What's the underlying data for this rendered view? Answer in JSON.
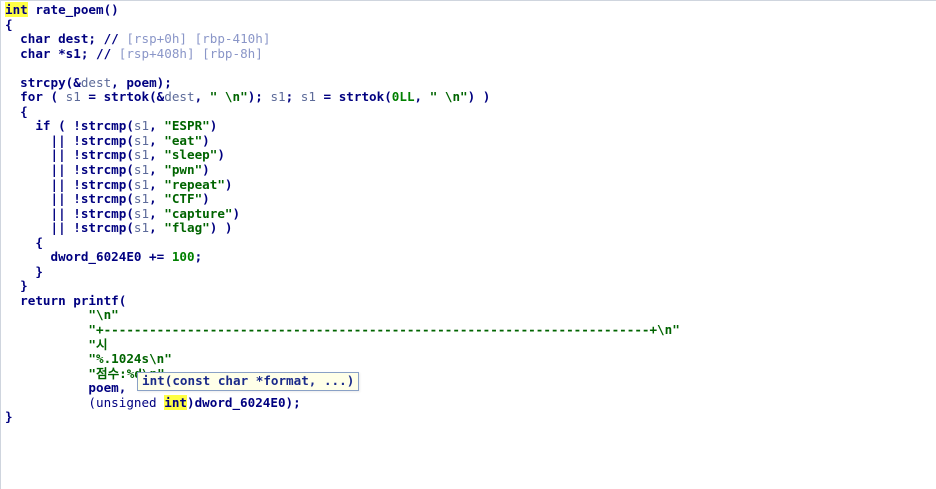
{
  "editor": {
    "lines": [
      [
        {
          "t": "int",
          "c": "kw hl"
        },
        {
          "t": " rate_poem()",
          "c": "id"
        }
      ],
      [
        {
          "t": "{",
          "c": "id"
        }
      ],
      [
        {
          "t": "  char ",
          "c": "kw"
        },
        {
          "t": "dest",
          "c": "id"
        },
        {
          "t": "; // ",
          "c": "id"
        },
        {
          "t": "[rsp+0h] [rbp-410h]",
          "c": "cmt"
        }
      ],
      [
        {
          "t": "  char *",
          "c": "kw"
        },
        {
          "t": "s1",
          "c": "id"
        },
        {
          "t": "; // ",
          "c": "id"
        },
        {
          "t": "[rsp+408h] [rbp-8h]",
          "c": "cmt"
        }
      ],
      [
        {
          "t": "",
          "c": "id"
        }
      ],
      [
        {
          "t": "  strcpy(&",
          "c": "id"
        },
        {
          "t": "dest",
          "c": "var"
        },
        {
          "t": ", poem);",
          "c": "id"
        }
      ],
      [
        {
          "t": "  for ( ",
          "c": "id"
        },
        {
          "t": "s1",
          "c": "var"
        },
        {
          "t": " = strtok(&",
          "c": "id"
        },
        {
          "t": "dest",
          "c": "var"
        },
        {
          "t": ", ",
          "c": "id"
        },
        {
          "t": "\" \\n\"",
          "c": "str"
        },
        {
          "t": "); ",
          "c": "id"
        },
        {
          "t": "s1",
          "c": "var"
        },
        {
          "t": "; ",
          "c": "id"
        },
        {
          "t": "s1",
          "c": "var"
        },
        {
          "t": " = strtok(",
          "c": "id"
        },
        {
          "t": "0LL",
          "c": "num"
        },
        {
          "t": ", ",
          "c": "id"
        },
        {
          "t": "\" \\n\"",
          "c": "str"
        },
        {
          "t": ") )",
          "c": "id"
        }
      ],
      [
        {
          "t": "  {",
          "c": "id"
        }
      ],
      [
        {
          "t": "    if ( !strcmp(",
          "c": "id"
        },
        {
          "t": "s1",
          "c": "var"
        },
        {
          "t": ", ",
          "c": "id"
        },
        {
          "t": "\"ESPR\"",
          "c": "str"
        },
        {
          "t": ")",
          "c": "id"
        }
      ],
      [
        {
          "t": "      || !strcmp(",
          "c": "id"
        },
        {
          "t": "s1",
          "c": "var"
        },
        {
          "t": ", ",
          "c": "id"
        },
        {
          "t": "\"eat\"",
          "c": "str"
        },
        {
          "t": ")",
          "c": "id"
        }
      ],
      [
        {
          "t": "      || !strcmp(",
          "c": "id"
        },
        {
          "t": "s1",
          "c": "var"
        },
        {
          "t": ", ",
          "c": "id"
        },
        {
          "t": "\"sleep\"",
          "c": "str"
        },
        {
          "t": ")",
          "c": "id"
        }
      ],
      [
        {
          "t": "      || !strcmp(",
          "c": "id"
        },
        {
          "t": "s1",
          "c": "var"
        },
        {
          "t": ", ",
          "c": "id"
        },
        {
          "t": "\"pwn\"",
          "c": "str"
        },
        {
          "t": ")",
          "c": "id"
        }
      ],
      [
        {
          "t": "      || !strcmp(",
          "c": "id"
        },
        {
          "t": "s1",
          "c": "var"
        },
        {
          "t": ", ",
          "c": "id"
        },
        {
          "t": "\"repeat\"",
          "c": "str"
        },
        {
          "t": ")",
          "c": "id"
        }
      ],
      [
        {
          "t": "      || !strcmp(",
          "c": "id"
        },
        {
          "t": "s1",
          "c": "var"
        },
        {
          "t": ", ",
          "c": "id"
        },
        {
          "t": "\"CTF\"",
          "c": "str"
        },
        {
          "t": ")",
          "c": "id"
        }
      ],
      [
        {
          "t": "      || !strcmp(",
          "c": "id"
        },
        {
          "t": "s1",
          "c": "var"
        },
        {
          "t": ", ",
          "c": "id"
        },
        {
          "t": "\"capture\"",
          "c": "str"
        },
        {
          "t": ")",
          "c": "id"
        }
      ],
      [
        {
          "t": "      || !strcmp(",
          "c": "id"
        },
        {
          "t": "s1",
          "c": "var"
        },
        {
          "t": ", ",
          "c": "id"
        },
        {
          "t": "\"flag\"",
          "c": "str"
        },
        {
          "t": ") )",
          "c": "id"
        }
      ],
      [
        {
          "t": "    {",
          "c": "id"
        }
      ],
      [
        {
          "t": "      dword_6024E0 += ",
          "c": "id"
        },
        {
          "t": "100",
          "c": "num"
        },
        {
          "t": ";",
          "c": "id"
        }
      ],
      [
        {
          "t": "    }",
          "c": "id"
        }
      ],
      [
        {
          "t": "  }",
          "c": "id"
        }
      ],
      [
        {
          "t": "  return printf(",
          "c": "id"
        }
      ],
      [
        {
          "t": "           ",
          "c": "id"
        },
        {
          "t": "\"\\n\"",
          "c": "str"
        }
      ],
      [
        {
          "t": "           ",
          "c": "id"
        },
        {
          "t": "\"+------------------------------------------------------------------------+\\n\"",
          "c": "str"
        }
      ],
      [
        {
          "t": "           ",
          "c": "id"
        },
        {
          "t": "\"시",
          "c": "str"
        }
      ],
      [
        {
          "t": "           ",
          "c": "id"
        },
        {
          "t": "\"%.1024s\\n\"",
          "c": "str"
        }
      ],
      [
        {
          "t": "           ",
          "c": "id"
        },
        {
          "t": "\"점수:%d\\n\",",
          "c": "str"
        }
      ],
      [
        {
          "t": "           poem,",
          "c": "id"
        }
      ],
      [
        {
          "t": "           (unsigned ",
          "c": "typ"
        },
        {
          "t": "int",
          "c": "kw hl"
        },
        {
          "t": ")dword_6024E0);",
          "c": "id"
        }
      ],
      [
        {
          "t": "}",
          "c": "id"
        }
      ]
    ]
  },
  "tooltip": {
    "text": "int(const char *format, ...)"
  }
}
